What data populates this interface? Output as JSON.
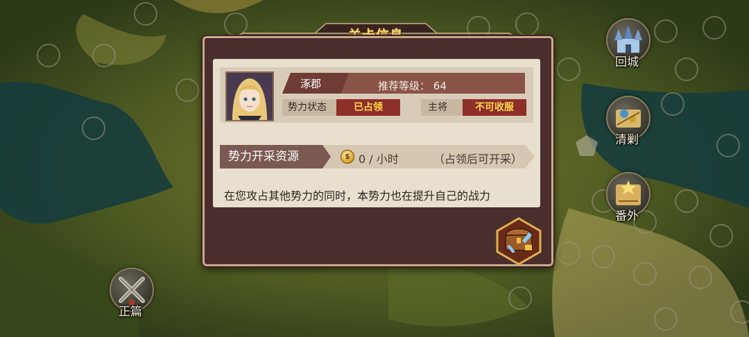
{
  "dialog": {
    "title": "关卡信息",
    "stage_name": "涿郡",
    "recommend_label": "推荐等级：",
    "recommend_level": "64",
    "faction_status_label": "势力状态",
    "faction_status_value": "已占领",
    "general_label": "主将",
    "general_value": "不可收服",
    "resource_label": "势力开采资源",
    "resource_icon": "gold-coin-icon",
    "resource_rate": "0 / 小时",
    "resource_note": "（占领后可开采）",
    "description": "在您攻占其他势力的同时，本势力也在提升自己的战力",
    "chest_icon": "treasure-chest-icon"
  },
  "side_buttons": [
    {
      "label": "回城",
      "icon": "castle-icon"
    },
    {
      "label": "清剿",
      "icon": "scroll-map-icon"
    },
    {
      "label": "番外",
      "icon": "treasure-map-icon"
    },
    {
      "label": "正篇",
      "icon": "crossed-swords-icon"
    }
  ],
  "colors": {
    "title": "#ffe27a",
    "status_value_bg": "#8e2f2a",
    "status_value_text": "#ffd94a",
    "dialog_bg": "#4a2e2e",
    "panel_bg": "#e9dfcf"
  }
}
